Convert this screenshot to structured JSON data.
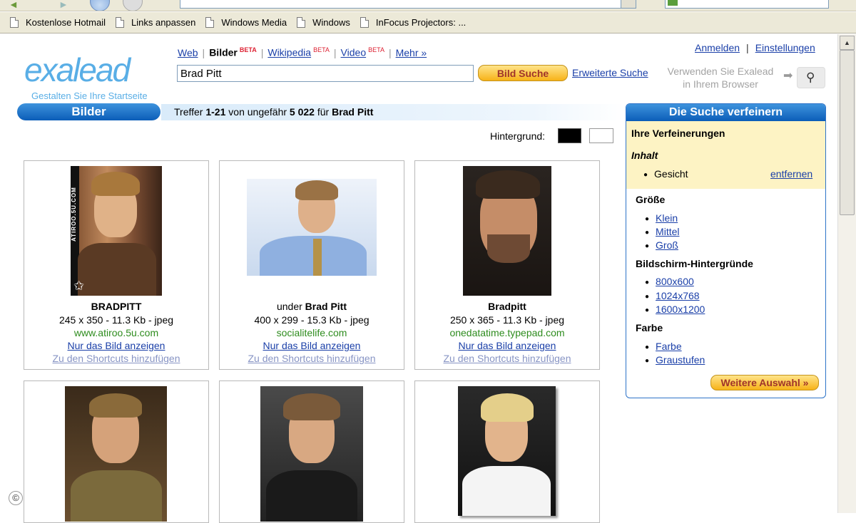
{
  "bookmarks": [
    {
      "label": "Kostenlose Hotmail"
    },
    {
      "label": "Links anpassen"
    },
    {
      "label": "Windows Media"
    },
    {
      "label": "Windows"
    },
    {
      "label": "InFocus Projectors: ..."
    }
  ],
  "header": {
    "logo_text": "exalead",
    "logo_sub": "Gestalten Sie Ihre Startseite",
    "tabs": [
      {
        "label": "Web"
      },
      {
        "label": "Bilder",
        "badge": "BETA"
      },
      {
        "label": "Wikipedia",
        "badge": "BETA"
      },
      {
        "label": "Video",
        "badge": "BETA"
      },
      {
        "label": "Mehr »"
      }
    ],
    "search_value": "Brad Pitt",
    "search_button": "Bild Suche",
    "advanced_link": "Erweiterte Suche",
    "promo_line1": "Verwenden Sie Exalead",
    "promo_line2": "in Ihrem Browser",
    "login": "Anmelden",
    "settings": "Einstellungen"
  },
  "results": {
    "section_label": "Bilder",
    "info_prefix": "Treffer ",
    "info_range": "1-21",
    "info_mid": " von ungefähr ",
    "info_count": "5 022",
    "info_for": " für ",
    "info_query": "Brad Pitt",
    "background_label": "Hintergrund:",
    "view_image_label": "Nur das Bild anzeigen",
    "add_shortcut_label": "Zu den Shortcuts hinzufügen",
    "items": [
      {
        "title_prefix": "",
        "title_bold": "BRADPITT",
        "meta": "245 x 350 - 11.3 Kb - jpeg",
        "source": "www.atiroo.5u.com",
        "watermark": "ATIROO.5U.COM"
      },
      {
        "title_prefix": "under ",
        "title_bold": "Brad Pitt",
        "meta": "400 x 299 - 15.3 Kb - jpeg",
        "source": "socialitelife.com"
      },
      {
        "title_prefix": "",
        "title_bold": "Bradpitt",
        "meta": "250 x 365 - 11.3 Kb - jpeg",
        "source": "onedatatime.typepad.com"
      },
      {},
      {},
      {}
    ]
  },
  "refine": {
    "title": "Die Suche verfeinern",
    "active_title": "Ihre Verfeinerungen",
    "content_label": "Inhalt",
    "active_item": "Gesicht",
    "remove_label": "entfernen",
    "size_title": "Größe",
    "sizes": [
      "Klein",
      "Mittel",
      "Groß"
    ],
    "wallpaper_title": "Bildschirm-Hintergründe",
    "wallpapers": [
      "800x600",
      "1024x768",
      "1600x1200"
    ],
    "color_title": "Farbe",
    "colors": [
      "Farbe",
      "Graustufen"
    ],
    "more_button": "Weitere Auswahl »"
  },
  "colors": {
    "accent_blue": "#0b5db8",
    "button_gold": "#f7b218",
    "link_blue": "#1a3fa8",
    "source_green": "#2e8c1e",
    "refine_highlight": "#fdf3c4"
  },
  "icons": [
    "back-arrow-icon",
    "forward-arrow-icon",
    "page-icon",
    "magnifier-icon",
    "arrow-right-icon",
    "star-icon",
    "copyright-icon"
  ]
}
